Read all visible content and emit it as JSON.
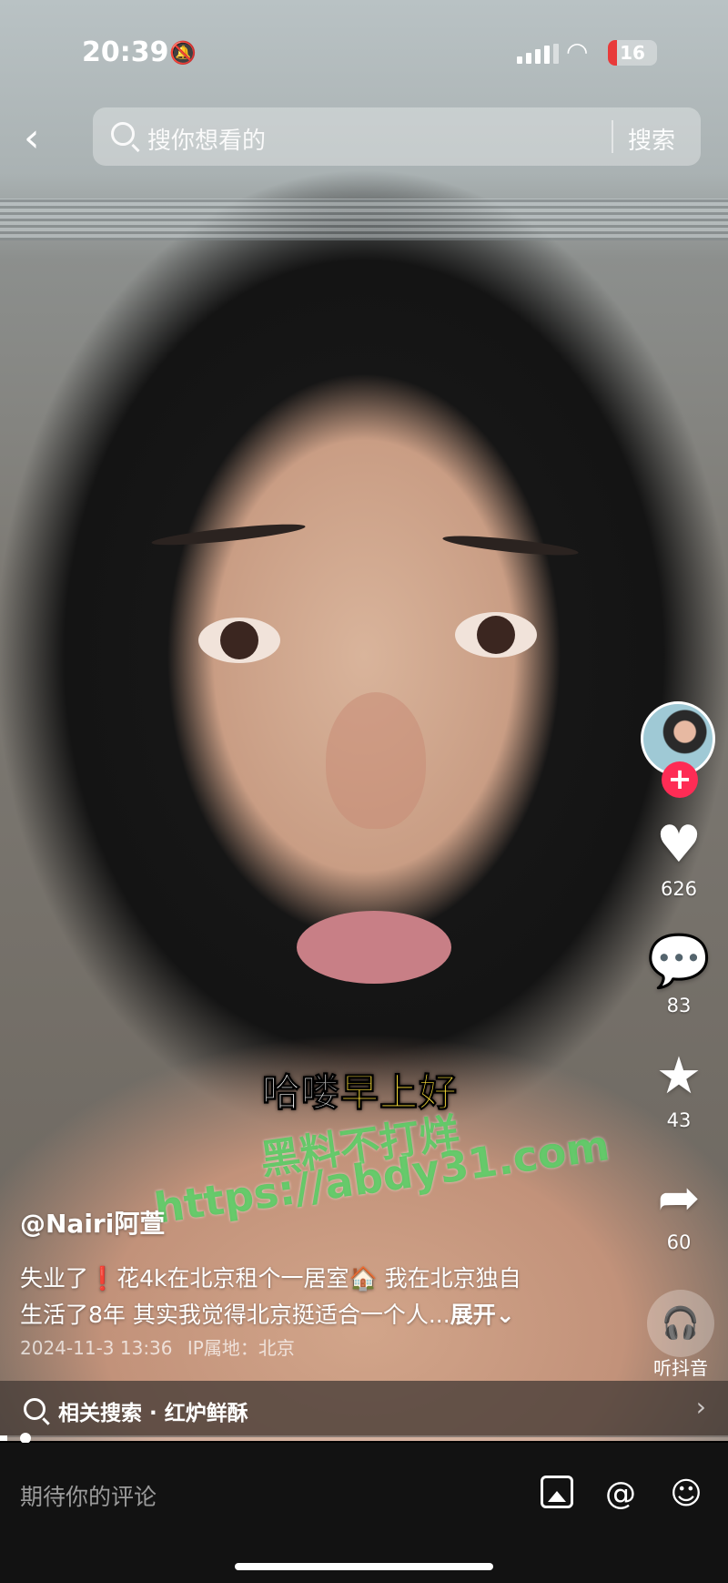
{
  "status_bar": {
    "time": "20:39",
    "battery": "16"
  },
  "search": {
    "placeholder": "搜你想看的",
    "button": "搜索"
  },
  "actions": {
    "likes": "626",
    "comments": "83",
    "favorites": "43",
    "shares": "60",
    "listen": "听抖音"
  },
  "captions": {
    "sub_white": "哈喽",
    "sub_yellow": "早上好",
    "watermark_line1": "黑料不打烊",
    "watermark_line2": "https://abdy31.com"
  },
  "author": "@Nairi阿萱",
  "description": {
    "line1": "失业了❗花4k在北京租个一居室🏠 我在北京独自",
    "line2": "生活了8年 其实我觉得北京挺适合一个人...",
    "more": "展开⌄"
  },
  "meta": {
    "date": "2024-11-3 13:36",
    "ip": "IP属地：北京"
  },
  "related": {
    "label": "相关搜索 · 红炉鲜酥"
  },
  "playback": {
    "progress_fraction": 0.01
  },
  "comment": {
    "placeholder": "期待你的评论"
  },
  "colors": {
    "follow": "#fe2c55",
    "caption_highlight": "#ffe23a",
    "watermark": "#50c85a"
  },
  "icons": [
    "back-icon",
    "search-icon",
    "heart-icon",
    "comment-icon",
    "star-icon",
    "share-icon",
    "headphones-icon",
    "image-icon",
    "at-icon",
    "emoji-icon"
  ]
}
